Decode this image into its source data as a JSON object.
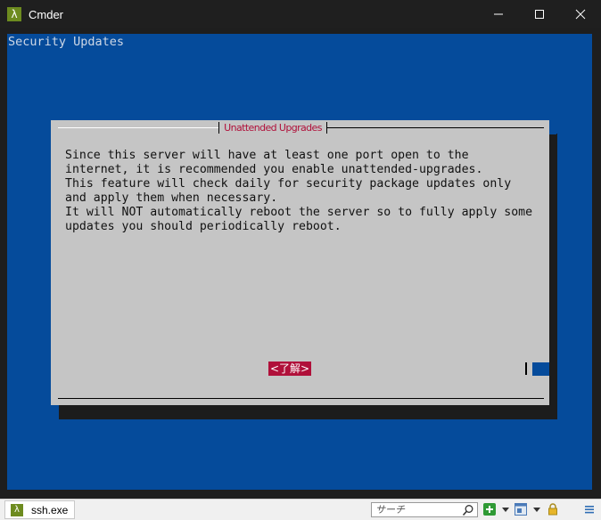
{
  "window": {
    "title": "Cmder",
    "app_icon_glyph": "λ"
  },
  "terminal": {
    "background_title": "Security Updates",
    "colors": {
      "background": "#054b9b",
      "dialog": "#c5c5c5",
      "accent": "#b0103a"
    }
  },
  "dialog": {
    "title": "Unattended Upgrades",
    "body": "Since this server will have at least one port open to the\ninternet, it is recommended you enable unattended-upgrades.\nThis feature will check daily for security package updates only\nand apply them when necessary.\nIt will NOT automatically reboot the server so to fully apply some\nupdates you should periodically reboot.",
    "ok_button": "<了解>"
  },
  "statusbar": {
    "tab_label": "ssh.exe",
    "tab_icon_glyph": "λ",
    "search_placeholder": "サーチ",
    "icons": [
      "new-console-icon",
      "dropdown-arrow-icon",
      "console-window-icon",
      "dropdown-arrow-icon",
      "lock-icon",
      "menu-icon"
    ]
  }
}
